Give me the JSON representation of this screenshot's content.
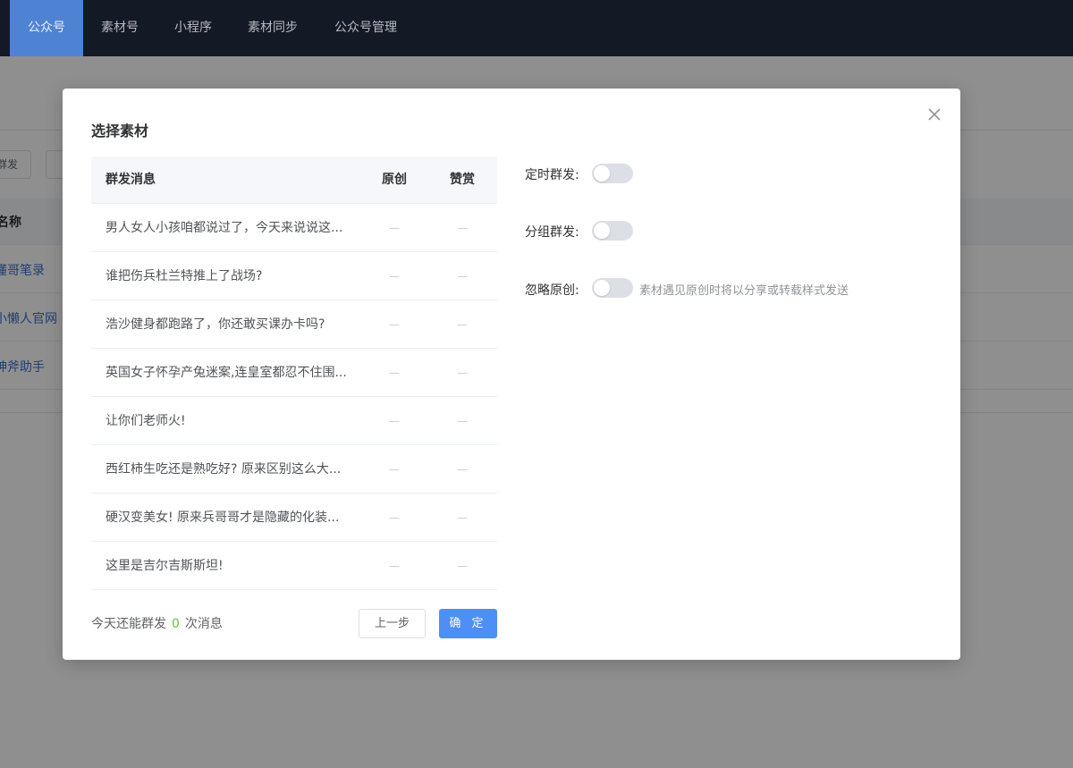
{
  "topnav": {
    "items": [
      {
        "label": "公众号",
        "active": true
      },
      {
        "label": "素材号",
        "active": false
      },
      {
        "label": "小程序",
        "active": false
      },
      {
        "label": "素材同步",
        "active": false
      },
      {
        "label": "公众号管理",
        "active": false
      }
    ]
  },
  "background": {
    "button_label": "群发",
    "table_header": "名称",
    "rows": [
      "懂哥笔录",
      "小懒人官网",
      "神斧助手"
    ]
  },
  "modal": {
    "title": "选择素材",
    "close_icon": "close-icon",
    "table": {
      "headers": {
        "title": "群发消息",
        "original": "原创",
        "reward": "赞赏"
      },
      "rows": [
        {
          "title": "男人女人小孩咱都说过了，今天来说说这...",
          "original": "—",
          "reward": "—"
        },
        {
          "title": "谁把伤兵杜兰特推上了战场?",
          "original": "—",
          "reward": "—"
        },
        {
          "title": "浩沙健身都跑路了，你还敢买课办卡吗?",
          "original": "—",
          "reward": "—"
        },
        {
          "title": "英国女子怀孕产兔迷案,连皇室都忍不住围...",
          "original": "—",
          "reward": "—"
        },
        {
          "title": "让你们老师火!",
          "original": "—",
          "reward": "—"
        },
        {
          "title": "西红柿生吃还是熟吃好? 原来区别这么大...",
          "original": "—",
          "reward": "—"
        },
        {
          "title": "硬汉变美女! 原来兵哥哥才是隐藏的化装...",
          "original": "—",
          "reward": "—"
        },
        {
          "title": "这里是吉尔吉斯斯坦!",
          "original": "—",
          "reward": "—"
        }
      ]
    },
    "quota": {
      "prefix": "今天还能群发",
      "count": "0",
      "suffix": "次消息"
    },
    "buttons": {
      "prev": "上一步",
      "confirm": "确 定"
    },
    "settings": {
      "scheduled": {
        "label": "定时群发:",
        "enabled": false
      },
      "group": {
        "label": "分组群发:",
        "enabled": false
      },
      "ignore_original": {
        "label": "忽略原创:",
        "enabled": false,
        "hint": "素材遇见原创时将以分享或转载样式发送"
      }
    }
  }
}
